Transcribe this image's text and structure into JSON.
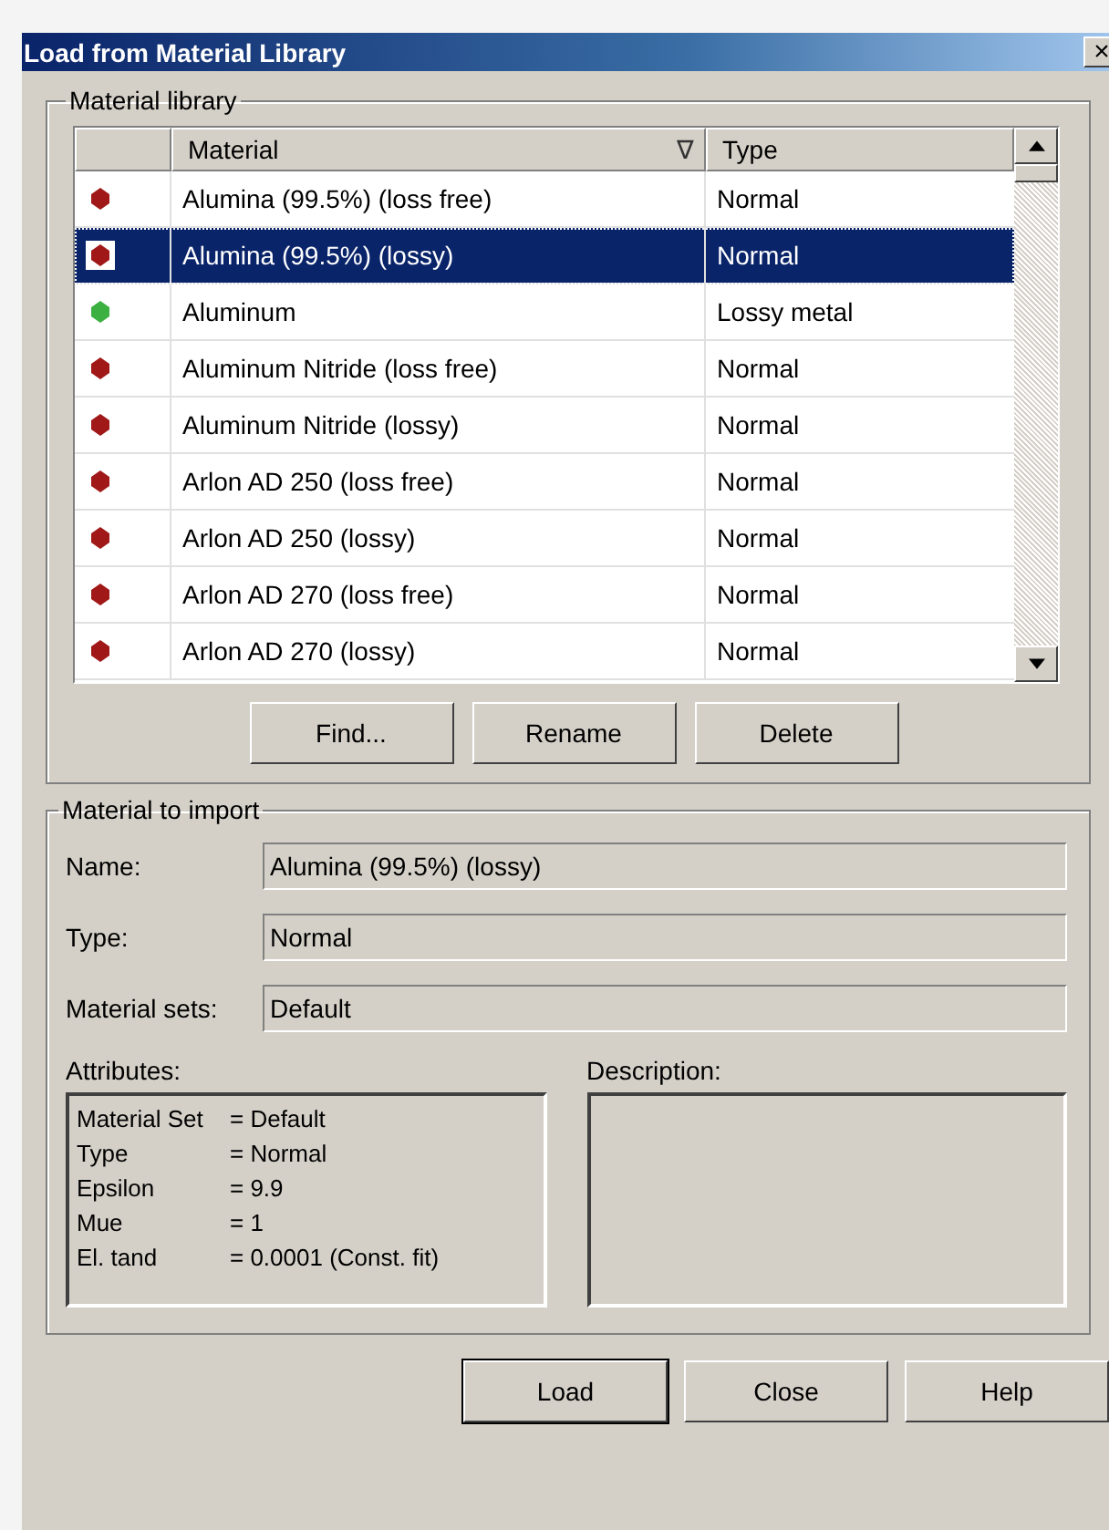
{
  "window": {
    "title": "Load from Material Library",
    "close": "×"
  },
  "library": {
    "title": "Material library",
    "columns": [
      {
        "label": "Material",
        "sort": "∇"
      },
      {
        "label": "Type"
      }
    ],
    "rows": [
      {
        "material": "Alumina (99.5%) (loss free)",
        "type": "Normal",
        "color": "#a01818",
        "selected": false
      },
      {
        "material": "Alumina (99.5%) (lossy)",
        "type": "Normal",
        "color": "#a01818",
        "selected": true
      },
      {
        "material": "Aluminum",
        "type": "Lossy metal",
        "color": "#3cb040",
        "selected": false
      },
      {
        "material": "Aluminum Nitride (loss free)",
        "type": "Normal",
        "color": "#a01818",
        "selected": false
      },
      {
        "material": "Aluminum Nitride (lossy)",
        "type": "Normal",
        "color": "#a01818",
        "selected": false
      },
      {
        "material": "Arlon AD 250 (loss free)",
        "type": "Normal",
        "color": "#a01818",
        "selected": false
      },
      {
        "material": "Arlon AD 250 (lossy)",
        "type": "Normal",
        "color": "#a01818",
        "selected": false
      },
      {
        "material": "Arlon AD 270 (loss free)",
        "type": "Normal",
        "color": "#a01818",
        "selected": false
      },
      {
        "material": "Arlon AD 270 (lossy)",
        "type": "Normal",
        "color": "#a01818",
        "selected": false
      }
    ],
    "buttons": [
      "Find...",
      "Rename",
      "Delete"
    ]
  },
  "import": {
    "title": "Material to import",
    "fields": [
      {
        "label": "Name:",
        "value": "Alumina (99.5%) (lossy)"
      },
      {
        "label": "Type:",
        "value": "Normal"
      },
      {
        "label": "Material sets:",
        "value": "Default"
      }
    ],
    "attributes_label": "Attributes:",
    "attributes": [
      {
        "key": "Material Set",
        "value": "= Default"
      },
      {
        "key": "Type",
        "value": "= Normal"
      },
      {
        "key": "Epsilon",
        "value": "= 9.9"
      },
      {
        "key": "Mue",
        "value": "= 1"
      },
      {
        "key": "El. tand",
        "value": "= 0.0001 (Const. fit)"
      }
    ],
    "description_label": "Description:"
  },
  "buttons": [
    {
      "label": "Load",
      "default": true
    },
    {
      "label": "Close",
      "default": false
    },
    {
      "label": "Help",
      "default": false
    }
  ]
}
